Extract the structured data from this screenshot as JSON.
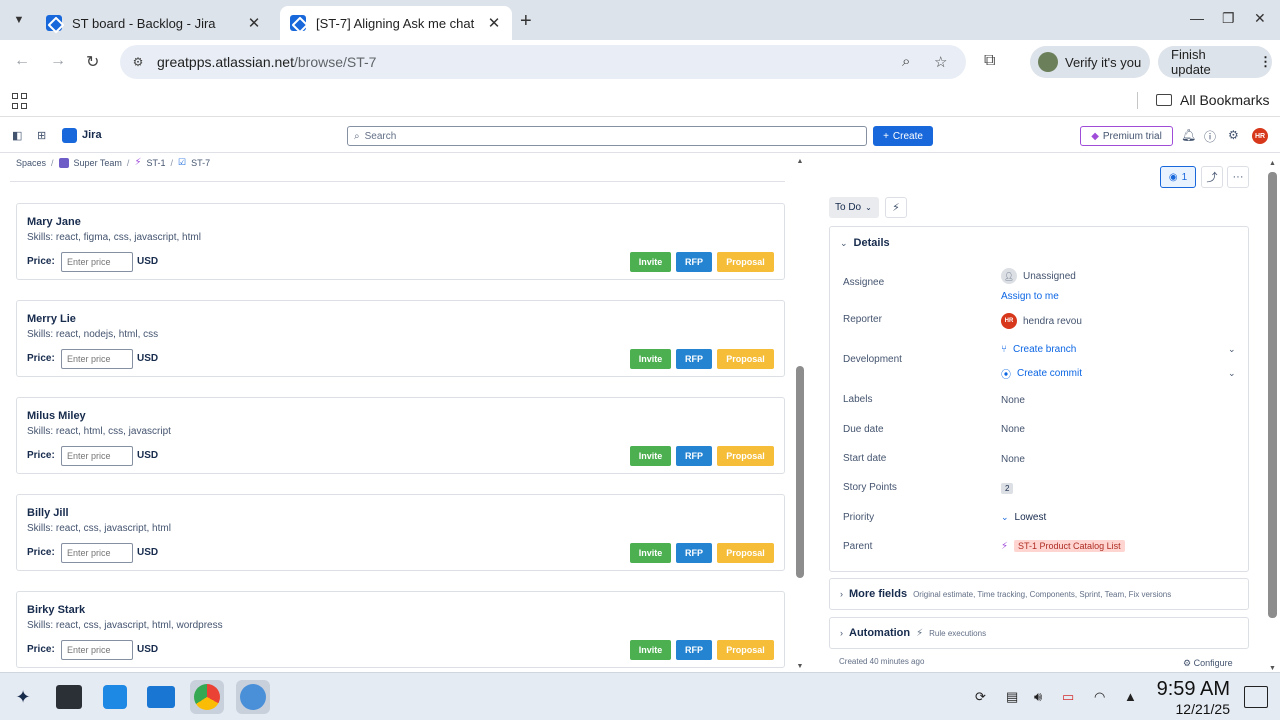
{
  "browser": {
    "tabs": [
      {
        "title": "ST board - Backlog - Jira"
      },
      {
        "title": "[ST-7] Aligning Ask me chat"
      }
    ],
    "url_host": "greatpps.atlassian.net",
    "url_path": "/browse/ST-7",
    "verify_label": "Verify it's you",
    "finish_update_label": "Finish update",
    "all_bookmarks_label": "All Bookmarks"
  },
  "jira_nav": {
    "product_name": "Jira",
    "search_placeholder": "Search",
    "create_label": "Create",
    "premium_label": "Premium trial",
    "avatar_initials": "HR"
  },
  "breadcrumb": {
    "items": [
      "Spaces",
      "Super Team",
      "ST-1",
      "ST-7"
    ]
  },
  "candidates": {
    "price_label": "Price:",
    "price_placeholder": "Enter price",
    "currency": "USD",
    "buttons": {
      "invite": "Invite",
      "rfp": "RFP",
      "proposal": "Proposal"
    },
    "colors": {
      "invite": "#4caf50",
      "rfp": "#2584d1",
      "proposal": "#f5bd38"
    },
    "items": [
      {
        "name": "Mary Jane",
        "skills": "Skills: react, figma, css, javascript, html"
      },
      {
        "name": "Merry Lie",
        "skills": "Skills: react, nodejs, html, css"
      },
      {
        "name": "Milus Miley",
        "skills": "Skills: react, html, css, javascript"
      },
      {
        "name": "Billy Jill",
        "skills": "Skills: react, css, javascript, html"
      },
      {
        "name": "Birky Stark",
        "skills": "Skills: react, css, javascript, html, wordpress"
      }
    ]
  },
  "issue_panel": {
    "watchers_count": "1",
    "status": "To Do",
    "details_title": "Details",
    "fields": {
      "assignee_label": "Assignee",
      "assignee_value": "Unassigned",
      "assign_to_me": "Assign to me",
      "reporter_label": "Reporter",
      "reporter_value": "hendra revou",
      "reporter_initials": "HR",
      "development_label": "Development",
      "create_branch": "Create branch",
      "create_commit": "Create commit",
      "labels_label": "Labels",
      "labels_value": "None",
      "due_date_label": "Due date",
      "due_date_value": "None",
      "start_date_label": "Start date",
      "start_date_value": "None",
      "story_points_label": "Story Points",
      "story_points_value": "2",
      "priority_label": "Priority",
      "priority_value": "Lowest",
      "parent_label": "Parent",
      "parent_value": "ST-1 Product Catalog List"
    },
    "more_fields_title": "More fields",
    "more_fields_sub": "Original estimate, Time tracking, Components, Sprint, Team, Fix versions",
    "automation_title": "Automation",
    "automation_sub": "Rule executions",
    "created_text": "Created 40 minutes ago",
    "configure_label": "Configure"
  },
  "taskbar": {
    "time": "9:59 AM",
    "date": "12/21/25"
  }
}
